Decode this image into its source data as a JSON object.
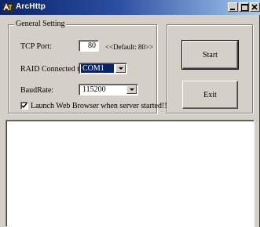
{
  "window": {
    "title": "ArcHttp",
    "app_icon": "archttp-app-icon",
    "controls": [
      "minimize-icon",
      "maximize-icon",
      "close-icon"
    ]
  },
  "general_setting": {
    "legend": "General Setting",
    "tcp_port": {
      "label": "TCP Port:",
      "value": "80",
      "hint": "<<Default: 80>>"
    },
    "raid": {
      "label": "RAID Connected to:",
      "selected": "COM1"
    },
    "baud": {
      "label": "BaudRate:",
      "selected": "115200"
    },
    "launch_browser": {
      "label": "Launch Web Browser when server started!!",
      "checked": true
    }
  },
  "buttons": {
    "start": "Start",
    "exit": "Exit"
  },
  "colors": {
    "titlebar_start": "#0a246a",
    "titlebar_end": "#a6caf0",
    "selection": "#0a246a",
    "face": "#d4d0c8"
  }
}
